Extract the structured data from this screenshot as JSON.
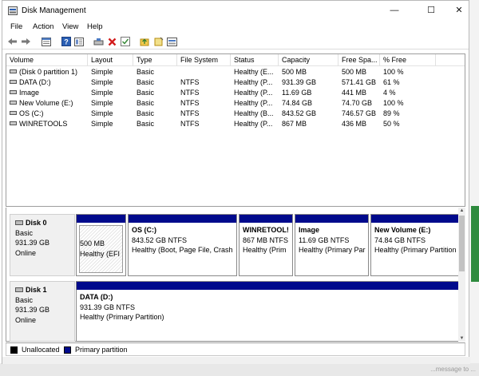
{
  "window": {
    "title": "Disk Management",
    "controls": {
      "minimize": "—",
      "maximize": "☐",
      "close": "✕"
    }
  },
  "menu": [
    "File",
    "Action",
    "View",
    "Help"
  ],
  "toolbar": [
    "back",
    "forward",
    "properties",
    "help",
    "details",
    "connect",
    "delete",
    "check",
    "up",
    "new",
    "rescan"
  ],
  "columns": [
    "Volume",
    "Layout",
    "Type",
    "File System",
    "Status",
    "Capacity",
    "Free Spa...",
    "% Free"
  ],
  "volumes": [
    {
      "volume": "(Disk 0 partition 1)",
      "layout": "Simple",
      "type": "Basic",
      "fs": "",
      "status": "Healthy (E...",
      "capacity": "500 MB",
      "free": "500 MB",
      "pct": "100 %"
    },
    {
      "volume": "DATA (D:)",
      "layout": "Simple",
      "type": "Basic",
      "fs": "NTFS",
      "status": "Healthy (P...",
      "capacity": "931.39 GB",
      "free": "571.41 GB",
      "pct": "61 %"
    },
    {
      "volume": "Image",
      "layout": "Simple",
      "type": "Basic",
      "fs": "NTFS",
      "status": "Healthy (P...",
      "capacity": "11.69 GB",
      "free": "441 MB",
      "pct": "4 %"
    },
    {
      "volume": "New Volume (E:)",
      "layout": "Simple",
      "type": "Basic",
      "fs": "NTFS",
      "status": "Healthy (P...",
      "capacity": "74.84 GB",
      "free": "74.70 GB",
      "pct": "100 %"
    },
    {
      "volume": "OS (C:)",
      "layout": "Simple",
      "type": "Basic",
      "fs": "NTFS",
      "status": "Healthy (B...",
      "capacity": "843.52 GB",
      "free": "746.57 GB",
      "pct": "89 %"
    },
    {
      "volume": "WINRETOOLS",
      "layout": "Simple",
      "type": "Basic",
      "fs": "NTFS",
      "status": "Healthy (P...",
      "capacity": "867 MB",
      "free": "436 MB",
      "pct": "50 %"
    }
  ],
  "disks": [
    {
      "name": "Disk 0",
      "kind": "Basic",
      "size": "931.39 GB",
      "state": "Online",
      "partitions": [
        {
          "title": "",
          "line1": "500 MB",
          "line2": "Healthy (EFI"
        },
        {
          "title": "OS  (C:)",
          "line1": "843.52 GB NTFS",
          "line2": "Healthy (Boot, Page File, Crash"
        },
        {
          "title": "WINRETOOL!",
          "line1": "867 MB NTFS",
          "line2": "Healthy (Prim"
        },
        {
          "title": "Image",
          "line1": "11.69 GB NTFS",
          "line2": "Healthy (Primary Par"
        },
        {
          "title": "New Volume  (E:)",
          "line1": "74.84 GB NTFS",
          "line2": "Healthy (Primary Partition"
        }
      ]
    },
    {
      "name": "Disk 1",
      "kind": "Basic",
      "size": "931.39 GB",
      "state": "Online",
      "partitions": [
        {
          "title": "DATA  (D:)",
          "line1": "931.39 GB NTFS",
          "line2": "Healthy (Primary Partition)"
        }
      ]
    }
  ],
  "legend": {
    "unallocated": "Unallocated",
    "primary": "Primary partition"
  },
  "background": {
    "ghost_text": "...message to ..."
  },
  "colors": {
    "primary_bar": "#000a8c",
    "unallocated": "#000000"
  }
}
